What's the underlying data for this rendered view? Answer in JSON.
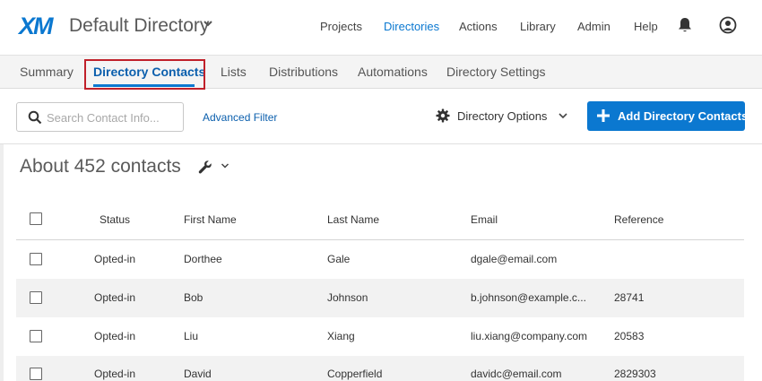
{
  "header": {
    "logo": "XM",
    "directory_title": "Default Directory",
    "nav": [
      "Projects",
      "Directories",
      "Actions",
      "Library",
      "Admin",
      "Help"
    ],
    "active_nav": "Directories"
  },
  "tabs": [
    "Summary",
    "Directory Contacts",
    "Lists",
    "Distributions",
    "Automations",
    "Directory Settings"
  ],
  "active_tab": "Directory Contacts",
  "toolbar": {
    "search_placeholder": "Search Contact Info...",
    "advanced_filter": "Advanced Filter",
    "directory_options": "Directory Options",
    "add_contacts": "Add Directory Contacts"
  },
  "contacts_count": "About 452 contacts",
  "table": {
    "columns": [
      "Status",
      "First Name",
      "Last Name",
      "Email",
      "Reference"
    ],
    "rows": [
      {
        "status": "Opted-in",
        "first": "Dorthee",
        "last": "Gale",
        "email": "dgale@email.com",
        "reference": ""
      },
      {
        "status": "Opted-in",
        "first": "Bob",
        "last": "Johnson",
        "email": "b.johnson@example.c...",
        "reference": "28741"
      },
      {
        "status": "Opted-in",
        "first": "Liu",
        "last": "Xiang",
        "email": "liu.xiang@company.com",
        "reference": "20583"
      },
      {
        "status": "Opted-in",
        "first": "David",
        "last": "Copperfield",
        "email": "davidc@email.com",
        "reference": "2829303"
      }
    ]
  },
  "colors": {
    "accent": "#0b78d0",
    "highlight": "#c0202a"
  }
}
